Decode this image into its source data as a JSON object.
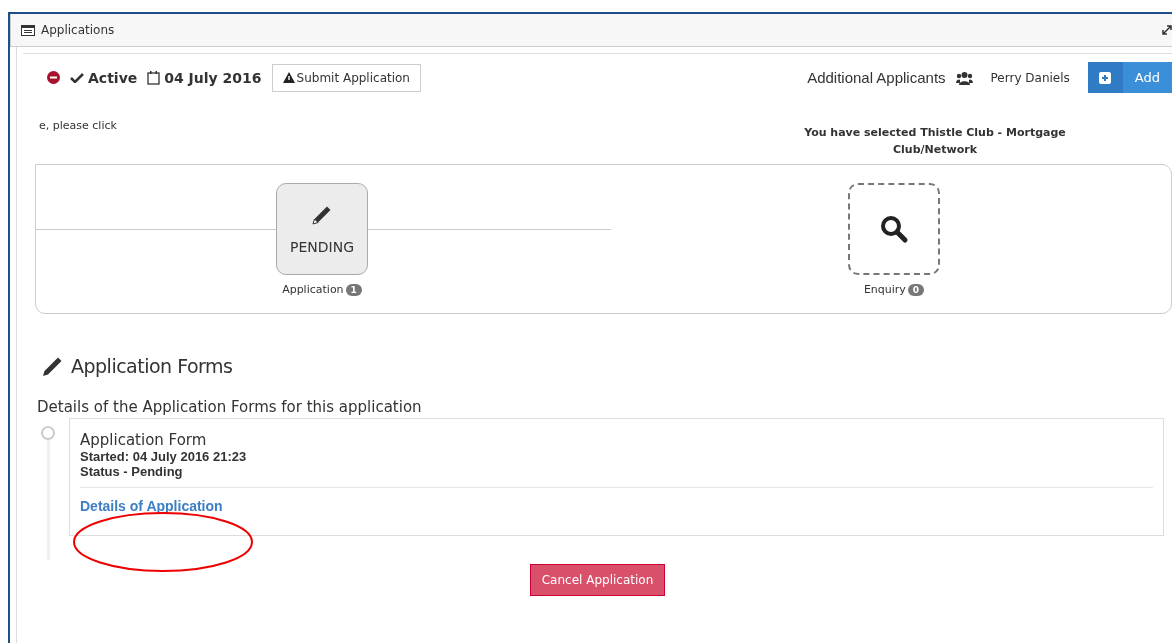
{
  "window": {
    "title": "Applications"
  },
  "toolbar": {
    "status": "Active",
    "date": "04 July 2016",
    "submit_button": "Submit Application",
    "additional_applicants": "Additional Applicants",
    "applicant": "Perry Daniels",
    "add_button": "Add"
  },
  "notice": "e, please click",
  "selection": "You have selected Thistle Club - Mortgage Club/Network",
  "stages": [
    {
      "kind": "pending",
      "status": "PENDING",
      "label": "Application",
      "count": "1"
    },
    {
      "kind": "enquiry",
      "label": "Enquiry",
      "count": "0"
    }
  ],
  "forms_section": {
    "title": "Application Forms",
    "description": "Details of the Application Forms for this application",
    "forms": [
      {
        "title": "Application Form",
        "started": "Started: 04 July 2016 21:23",
        "status": "Status - Pending",
        "link": "Details of Application"
      }
    ]
  },
  "cancel_button": "Cancel Application"
}
